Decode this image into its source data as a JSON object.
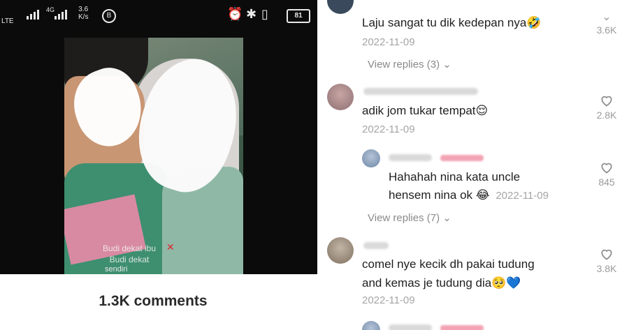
{
  "status_bar": {
    "network": "LTE",
    "net2": "4G",
    "speed_value": "3.6",
    "speed_unit": "K/s",
    "badge": "B",
    "alarm_icon": "alarm-icon",
    "bluetooth_icon": "bluetooth-icon",
    "vibrate_icon": "vibrate-icon",
    "battery_level": "81"
  },
  "video": {
    "caption_line1": "Budi dekat ibu",
    "caption_line2": "Budi dekat",
    "caption_line3": "sendiri"
  },
  "left": {
    "comments_title": "1.3K comments"
  },
  "comments": [
    {
      "text": "Laju sangat tu dik kedepan nya🤣",
      "date": "2022-11-09",
      "likes": "3.6K",
      "view_replies": "View replies (3)"
    },
    {
      "text": "adik jom tukar tempat😌",
      "date": "2022-11-09",
      "likes": "2.8K"
    },
    {
      "reply": true,
      "text_line1": "Hahahah nina kata uncle",
      "text_line2": "hensem nina ok 😂",
      "date": "2022-11-09",
      "likes": "845",
      "view_replies": "View replies (7)"
    },
    {
      "text_line1": "comel nye kecik dh pakai tudung",
      "text_line2": "and kemas je tudung dia🥺💙",
      "date": "2022-11-09",
      "likes": "3.8K"
    }
  ],
  "colors": {
    "accent_creator": "#f3a4b4",
    "muted_text": "#a5a5a5",
    "text": "#1f1f1f"
  }
}
